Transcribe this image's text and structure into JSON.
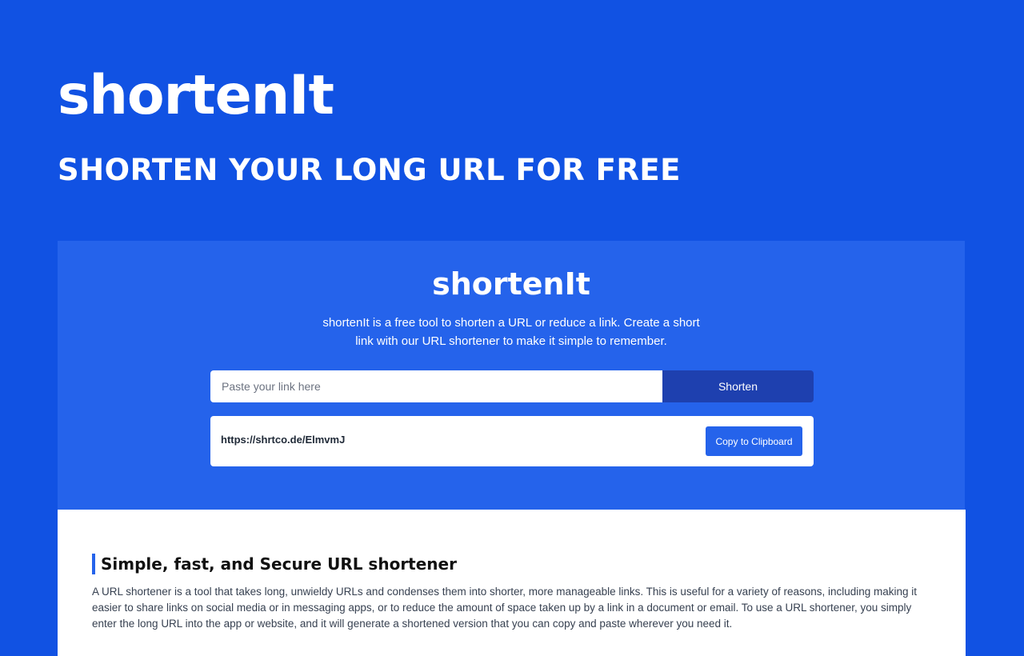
{
  "hero": {
    "title": "shortenIt",
    "subtitle": "SHORTEN YOUR LONG URL FOR FREE"
  },
  "card": {
    "title": "shortenIt",
    "description": "shortenIt is a free tool to shorten a URL or reduce a link. Create a short link with our URL shortener to make it simple to remember.",
    "input": {
      "placeholder": "Paste your link here",
      "value": ""
    },
    "shorten_label": "Shorten",
    "result": {
      "link": "https://shrtco.de/ElmvmJ",
      "copy_label": "Copy to Clipboard"
    }
  },
  "info": {
    "heading": "Simple, fast, and Secure URL shortener",
    "body": "A URL shortener is a tool that takes long, unwieldy URLs and condenses them into shorter, more manageable links. This is useful for a variety of reasons, including making it easier to share links on social media or in messaging apps, or to reduce the amount of space taken up by a link in a document or email. To use a URL shortener, you simply enter the long URL into the app or website, and it will generate a shortened version that you can copy and paste wherever you need it."
  },
  "colors": {
    "background": "#1152e3",
    "card": "#2563eb",
    "button_dark": "#1e40af",
    "accent": "#2563eb"
  }
}
